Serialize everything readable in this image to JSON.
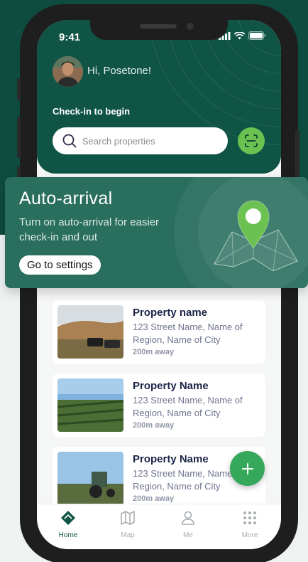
{
  "status": {
    "time": "9:41"
  },
  "header": {
    "greeting": "Hi, Posetone!",
    "checkin_label": "Check-in to begin"
  },
  "search": {
    "placeholder": "Search properties",
    "value": ""
  },
  "banner": {
    "title": "Auto-arrival",
    "text": "Turn on auto-arrival for easier check-in and out",
    "button_label": "Go to settings"
  },
  "properties": [
    {
      "name": "Property name",
      "address": "123 Street Name, Name of Region, Name of City",
      "distance": "200m away"
    },
    {
      "name": "Property Name",
      "address": "123 Street Name, Name of Region, Name of City",
      "distance": "200m away"
    },
    {
      "name": "Property Name",
      "address": "123 Street Name, Name of Region, Name of City",
      "distance": "200m away"
    }
  ],
  "tabs": [
    {
      "label": "Home",
      "icon": "home-icon",
      "active": true
    },
    {
      "label": "Map",
      "icon": "map-icon",
      "active": false
    },
    {
      "label": "Me",
      "icon": "user-icon",
      "active": false
    },
    {
      "label": "More",
      "icon": "grid-icon",
      "active": false
    }
  ],
  "colors": {
    "brand": "#0f5445",
    "accent": "#6cc250",
    "fab": "#36a85c"
  }
}
